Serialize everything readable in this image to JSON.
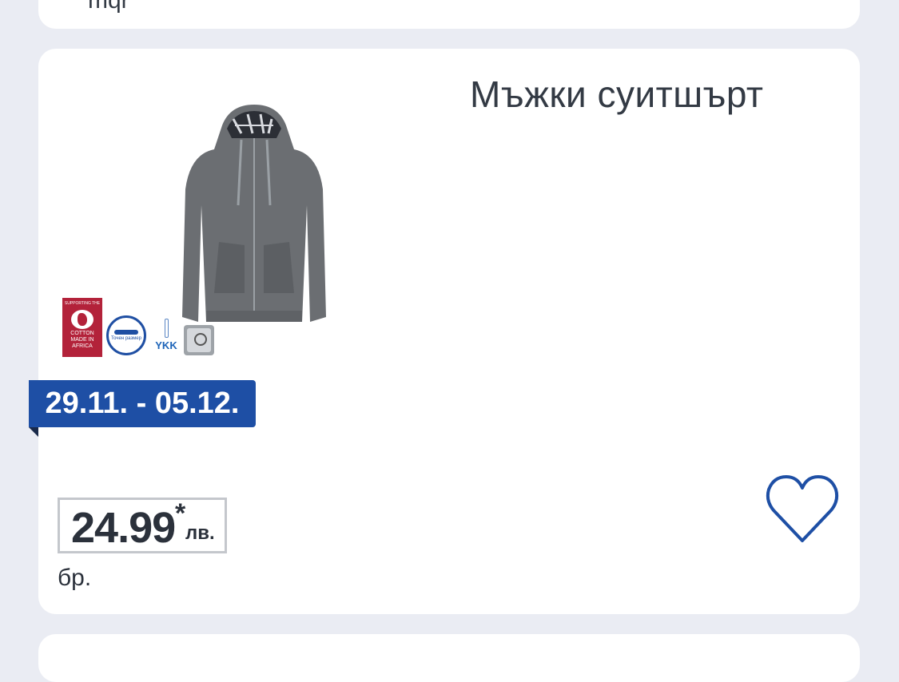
{
  "previous_card": {
    "cut_text": "mqr"
  },
  "product": {
    "title": "Мъжки суитшърт",
    "badges": {
      "cotton": {
        "top": "SUPPORTING THE",
        "lines": [
          "COTTON",
          "MADE IN",
          "AFRICA"
        ]
      },
      "fit": {
        "label": "Точен размер"
      },
      "ykk": {
        "label": "YKK"
      },
      "safe": {
        "icon": "safe-icon"
      }
    },
    "date_range": "29.11. - 05.12.",
    "price": {
      "value": "24.99",
      "star": "*",
      "currency": "лв."
    },
    "unit": "бр.",
    "favorite_icon": "heart-icon"
  },
  "colors": {
    "accent": "#1e4fa5",
    "text": "#333a44",
    "background": "#eaecf3"
  }
}
